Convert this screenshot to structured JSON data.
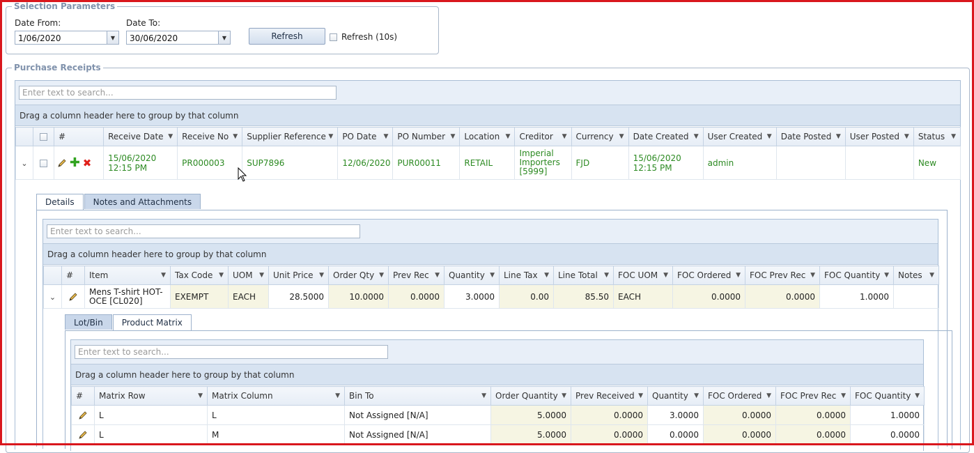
{
  "selection": {
    "legend": "Selection Parameters",
    "date_from_label": "Date From:",
    "date_from_value": "1/06/2020",
    "date_to_label": "Date To:",
    "date_to_value": "30/06/2020",
    "refresh_label": "Refresh",
    "auto_refresh_label": "Refresh (10s)"
  },
  "receipts": {
    "legend": "Purchase Receipts",
    "search_placeholder": "Enter text to search...",
    "group_hint": "Drag a column header here to group by that column",
    "columns": [
      "#",
      "Receive Date",
      "Receive No",
      "Supplier Reference",
      "PO Date",
      "PO Number",
      "Location",
      "Creditor",
      "Currency",
      "Date Created",
      "User Created",
      "Date Posted",
      "User Posted",
      "Status"
    ],
    "row": {
      "receive_date_1": "15/06/2020",
      "receive_date_2": "12:15 PM",
      "receive_no": "PR000003",
      "supplier_ref": "SUP7896",
      "po_date": "12/06/2020",
      "po_number": "PUR00011",
      "location": "RETAIL",
      "creditor_1": "Imperial",
      "creditor_2": "Importers",
      "creditor_3": "[5999]",
      "currency": "FJD",
      "date_created_1": "15/06/2020",
      "date_created_2": "12:15 PM",
      "user_created": "admin",
      "date_posted": "",
      "user_posted": "",
      "status": "New"
    }
  },
  "detail_tabs": [
    "Details",
    "Notes and Attachments"
  ],
  "details": {
    "search_placeholder": "Enter text to search...",
    "group_hint": "Drag a column header here to group by that column",
    "columns": [
      "#",
      "Item",
      "Tax Code",
      "UOM",
      "Unit Price",
      "Order Qty",
      "Prev Rec",
      "Quantity",
      "Line Tax",
      "Line Total",
      "FOC UOM",
      "FOC Ordered",
      "FOC Prev Rec",
      "FOC Quantity",
      "Notes"
    ],
    "row": {
      "item_1": "Mens T-shirt HOT-",
      "item_2": "OCE [CL020]",
      "tax_code": "EXEMPT",
      "uom": "EACH",
      "unit_price": "28.5000",
      "order_qty": "10.0000",
      "prev_rec": "0.0000",
      "quantity": "3.0000",
      "line_tax": "0.00",
      "line_total": "85.50",
      "foc_uom": "EACH",
      "foc_ordered": "0.0000",
      "foc_prev_rec": "0.0000",
      "foc_quantity": "1.0000",
      "notes": ""
    }
  },
  "sub_tabs": [
    "Lot/Bin",
    "Product Matrix"
  ],
  "matrix": {
    "search_placeholder": "Enter text to search...",
    "group_hint": "Drag a column header here to group by that column",
    "columns": [
      "#",
      "Matrix Row",
      "Matrix Column",
      "Bin To",
      "Order Quantity",
      "Prev Received",
      "Quantity",
      "FOC Ordered",
      "FOC Prev Rec",
      "FOC Quantity"
    ],
    "rows": [
      {
        "row": "L",
        "col": "L",
        "bin": "Not Assigned [N/A]",
        "order_qty": "5.0000",
        "prev": "0.0000",
        "qty": "3.0000",
        "foc_ord": "0.0000",
        "foc_prev": "0.0000",
        "foc_qty": "1.0000"
      },
      {
        "row": "L",
        "col": "M",
        "bin": "Not Assigned [N/A]",
        "order_qty": "5.0000",
        "prev": "0.0000",
        "qty": "0.0000",
        "foc_ord": "0.0000",
        "foc_prev": "0.0000",
        "foc_qty": "0.0000"
      }
    ]
  },
  "icons": {
    "edit": "pencil-icon",
    "add": "plus-icon",
    "delete": "close-icon",
    "expand": "chevron-down-icon",
    "filter": "filter-icon",
    "cursor": "mouse-pointer-icon"
  },
  "colors": {
    "frame": "#d9171d",
    "green_text": "#2c8a22",
    "editable_cell": "#f6f5e3"
  }
}
